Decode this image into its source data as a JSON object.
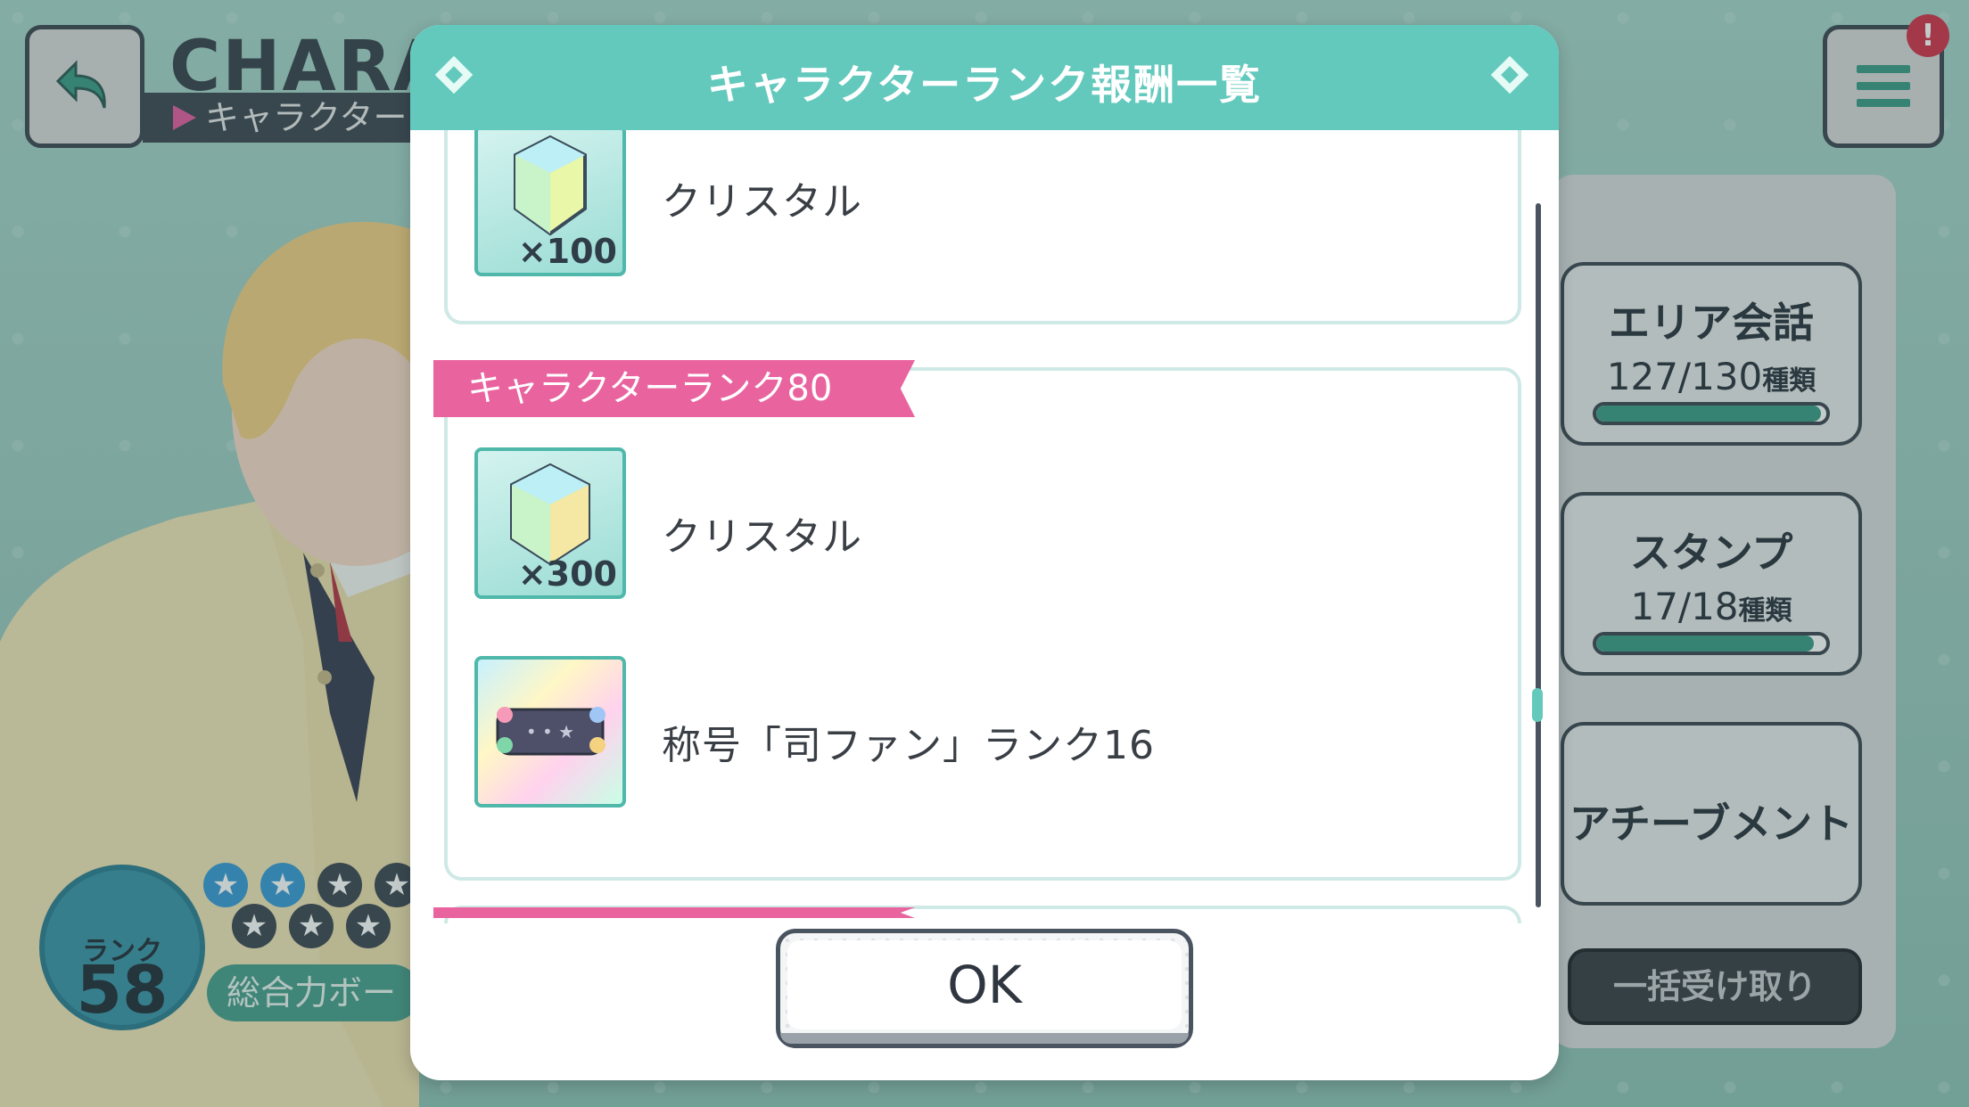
{
  "background": {
    "title": "CHARA",
    "subtitle": "キャラクター",
    "rank_label": "ランク",
    "rank_value": "58",
    "power_label": "総合力ボー",
    "alert_icon": "!",
    "stars": {
      "filled": 2,
      "total": 7
    },
    "cards": [
      {
        "title": "エリア会話",
        "count": "127/130",
        "unit": "種類",
        "progress": 0.977
      },
      {
        "title": "スタンプ",
        "count": "17/18",
        "unit": "種類",
        "progress": 0.944
      },
      {
        "title": "アチーブメント"
      }
    ],
    "claim_all_label": "一括受け取り"
  },
  "modal": {
    "title": "キャラクターランク報酬一覧",
    "groups": [
      {
        "items": [
          {
            "icon": "crystal-icon",
            "quantity": "×100",
            "label": "クリスタル"
          }
        ]
      },
      {
        "ribbon": "キャラクターランク80",
        "items": [
          {
            "icon": "crystal-icon",
            "quantity": "×300",
            "label": "クリスタル"
          },
          {
            "icon": "title-plate-icon",
            "label": "称号「司ファン」ランク16"
          }
        ]
      }
    ],
    "ok_label": "OK"
  },
  "colors": {
    "header": "#63c9bd",
    "ribbon": "#e9649f",
    "dark": "#3f4853"
  }
}
